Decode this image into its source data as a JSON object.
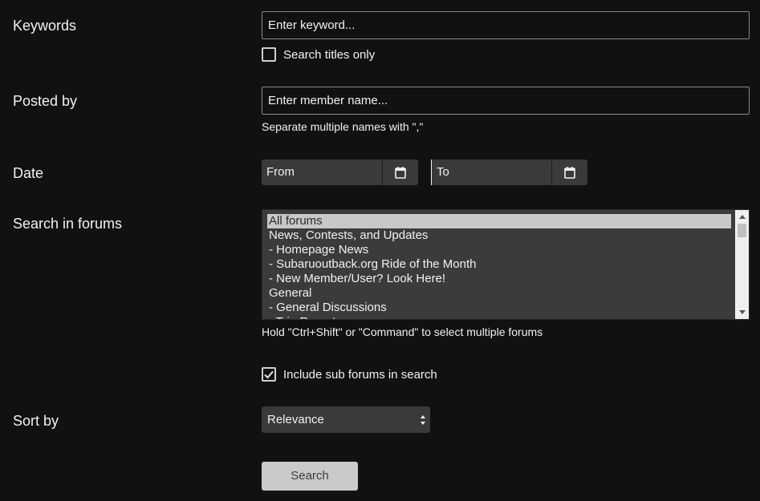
{
  "keywords": {
    "label": "Keywords",
    "placeholder": "Enter keyword...",
    "titles_only_label": "Search titles only",
    "titles_only_checked": false
  },
  "posted_by": {
    "label": "Posted by",
    "placeholder": "Enter member name...",
    "hint": "Separate multiple names with \",\""
  },
  "date": {
    "label": "Date",
    "from": "From",
    "to": "To",
    "icon": "calendar-icon"
  },
  "forums": {
    "label": "Search in forums",
    "items": [
      "All forums",
      "News, Contests, and Updates",
      "- Homepage News",
      "- Subaruoutback.org Ride of the Month",
      "- New Member/User? Look Here!",
      "General",
      "- General Discussions",
      "- Trip Reports"
    ],
    "selected_index": 0,
    "hint": "Hold \"Ctrl+Shift\" or \"Command\" to select multiple forums",
    "include_sub_label": "Include sub forums in search",
    "include_sub_checked": true
  },
  "sort": {
    "label": "Sort by",
    "value": "Relevance"
  },
  "search_button": "Search"
}
